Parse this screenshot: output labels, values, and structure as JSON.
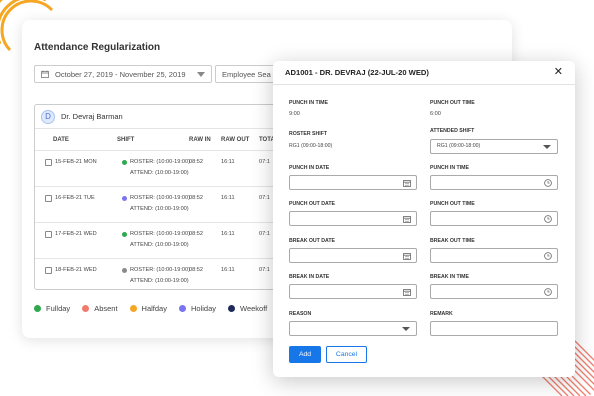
{
  "colors": {
    "fullday": "#2fa84f",
    "absent": "#f07b6c",
    "halfday": "#f5a623",
    "holiday": "#7b74f0",
    "weekoff": "#1f2a5a",
    "accent": "#1877e8",
    "deco": "#f5a623"
  },
  "page": {
    "title": "Attendance Regularization",
    "date_range": "October 27, 2019 - November 25, 2019",
    "employee_search_placeholder": "Employee Sea"
  },
  "employee": {
    "initial": "D",
    "name": "Dr. Devraj Barman"
  },
  "table": {
    "columns": [
      "DATE",
      "SHIFT",
      "RAW IN",
      "RAW OUT",
      "TOTA"
    ],
    "rows": [
      {
        "date": "15-FEB-21 MON",
        "roster": "ROSTER: (10:00-19:00)",
        "attend": "ATTEND: (10:00-19:00)",
        "raw_in": "08:52",
        "raw_out": "16:11",
        "total": "07:1",
        "status": "fullday"
      },
      {
        "date": "16-FEB-21 TUE",
        "roster": "ROSTER: (10:00-19:00)",
        "attend": "ATTEND: (10:00-19:00)",
        "raw_in": "08:52",
        "raw_out": "16:11",
        "total": "07:1",
        "status": "holiday"
      },
      {
        "date": "17-FEB-21 WED",
        "roster": "ROSTER: (10:00-19:00)",
        "attend": "ATTEND: (10:00-19:00)",
        "raw_in": "08:52",
        "raw_out": "16:11",
        "total": "07:1",
        "status": "fullday"
      },
      {
        "date": "18-FEB-21 WED",
        "roster": "ROSTER: (10:00-19:00)",
        "attend": "ATTEND: (10:00-19:00)",
        "raw_in": "08:52",
        "raw_out": "16:11",
        "total": "07:1",
        "status": "weekoff"
      }
    ]
  },
  "legend": [
    {
      "label": "Fullday",
      "color": "#2fa84f"
    },
    {
      "label": "Absent",
      "color": "#f07b6c"
    },
    {
      "label": "Halfday",
      "color": "#f5a623"
    },
    {
      "label": "Holiday",
      "color": "#7b74f0"
    },
    {
      "label": "Weekoff",
      "color": "#1f2a5a"
    }
  ],
  "modal": {
    "title": "AD1001 - DR. DEVRAJ (22-JUL-20 WED)",
    "close_glyph": "✕",
    "punch_in_time_label": "PUNCH IN TIME",
    "punch_in_time_value": "9:00",
    "punch_out_time_label": "PUNCH OUT TIME",
    "punch_out_time_value": "6:00",
    "roster_shift_label": "ROSTER SHIFT",
    "roster_shift_value": "RG1 (09:00-18:00)",
    "attended_shift_label": "ATTENDED SHIFT",
    "attended_shift_value": "RG1 (09:00-18:00)",
    "punch_in_date_label": "PUNCH IN DATE",
    "punch_in_time_field_label": "PUNCH IN TIME",
    "punch_out_date_label": "PUNCH OUT DATE",
    "punch_out_time_field_label": "PUNCH OUT TIME",
    "break_out_date_label": "BREAK OUT DATE",
    "break_out_time_label": "BREAK OUT TIME",
    "break_in_date_label": "BREAK IN DATE",
    "break_in_time_label": "BREAK IN TIME",
    "reason_label": "REASON",
    "remark_label": "REMARK",
    "add_label": "Add",
    "cancel_label": "Cancel"
  }
}
